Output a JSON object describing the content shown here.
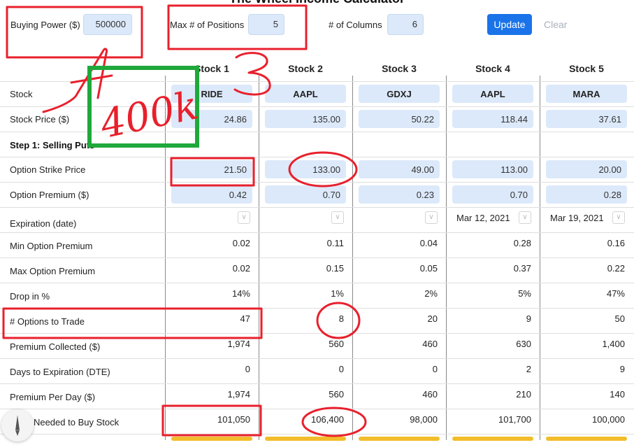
{
  "title": "The Wheel Income Calculator",
  "controls": {
    "buying_power_label": "Buying Power ($)",
    "buying_power_value": "500000",
    "max_positions_label": "Max # of Positions",
    "max_positions_value": "5",
    "columns_label": "# of Columns",
    "columns_value": "6",
    "update_label": "Update",
    "clear_label": "Clear"
  },
  "table": {
    "columns": [
      "Stock 1",
      "Stock 2",
      "Stock 3",
      "Stock 4",
      "Stock 5"
    ],
    "row_labels": {
      "stock": "Stock",
      "stock_price": "Stock Price ($)",
      "section1": "Step 1: Selling Puts",
      "strike": "Option Strike Price",
      "premium": "Option Premium ($)",
      "expiration": "Expiration (date)",
      "min_premium": "Min Option Premium",
      "max_premium": "Max Option Premium",
      "drop": "Drop in %",
      "options_to_trade": "# Options to Trade",
      "premium_collected": "Premium Collected ($)",
      "dte": "Days to Expiration (DTE)",
      "premium_per_day": "Premium Per Day ($)",
      "cash_needed": "Cash Needed to Buy Stock"
    },
    "stock": [
      "RIDE",
      "AAPL",
      "GDXJ",
      "AAPL",
      "MARA"
    ],
    "stock_price": [
      "24.86",
      "135.00",
      "50.22",
      "118.44",
      "37.61"
    ],
    "strike": [
      "21.50",
      "133.00",
      "49.00",
      "113.00",
      "20.00"
    ],
    "premium": [
      "0.42",
      "0.70",
      "0.23",
      "0.70",
      "0.28"
    ],
    "expiration": [
      "",
      "",
      "",
      "Mar 12, 2021",
      "Mar 19, 2021"
    ],
    "min_premium": [
      "0.02",
      "0.11",
      "0.04",
      "0.28",
      "0.16"
    ],
    "max_premium": [
      "0.02",
      "0.15",
      "0.05",
      "0.37",
      "0.22"
    ],
    "drop": [
      "14%",
      "1%",
      "2%",
      "5%",
      "47%"
    ],
    "options_to_trade": [
      "47",
      "8",
      "20",
      "9",
      "50"
    ],
    "premium_collected": [
      "1,974",
      "560",
      "460",
      "630",
      "1,400"
    ],
    "dte": [
      "0",
      "0",
      "0",
      "2",
      "9"
    ],
    "premium_per_day": [
      "1,974",
      "560",
      "460",
      "210",
      "140"
    ],
    "cash_needed": [
      "101,050",
      "106,400",
      "98,000",
      "101,700",
      "100,000"
    ]
  },
  "annotations": {
    "handwriting": "400k",
    "red_number_1": "1",
    "red_number_3": "3",
    "colors": {
      "red": "#e8202c",
      "green": "#1fa83b"
    }
  },
  "icons": {
    "pencil_tool": "pencil-icon"
  }
}
